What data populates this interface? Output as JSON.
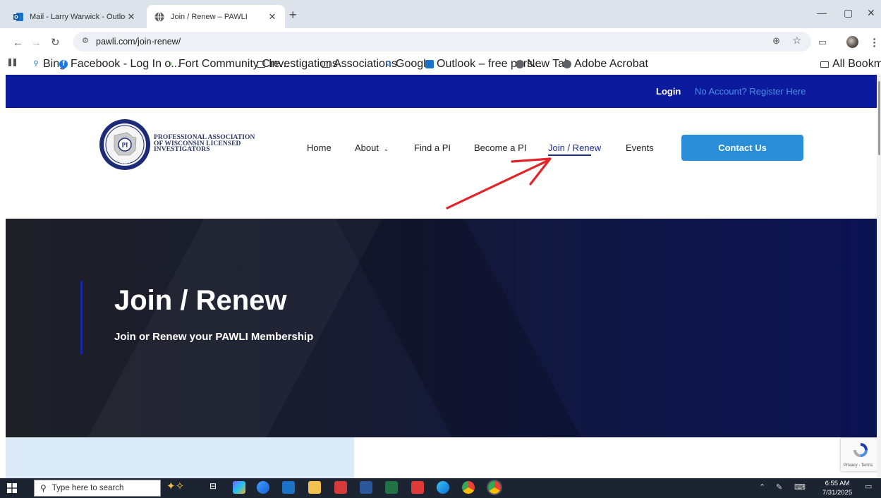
{
  "browser": {
    "tabs": [
      {
        "title": "Mail - Larry Warwick - Outlook",
        "active": false
      },
      {
        "title": "Join / Renew – PAWLI",
        "active": true
      }
    ],
    "new_tab_icon": "plus-icon",
    "url": "pawli.com/join-renew/",
    "bookmarks": [
      {
        "label": "Bing",
        "icon": "search-icon"
      },
      {
        "label": "Facebook - Log In o...",
        "icon": "facebook-icon"
      },
      {
        "label": "Fort Community Cre...",
        "icon": "bank-icon"
      },
      {
        "label": "Investigations",
        "icon": "folder-icon"
      },
      {
        "label": "Associations",
        "icon": "folder-icon"
      },
      {
        "label": "Google",
        "icon": "google-icon"
      },
      {
        "label": "Outlook – free pers...",
        "icon": "outlook-icon"
      },
      {
        "label": "New Tab",
        "icon": "globe-icon"
      },
      {
        "label": "Adobe Acrobat",
        "icon": "globe-icon"
      }
    ],
    "all_bookmarks": "All Bookmarks"
  },
  "site": {
    "topbar": {
      "login": "Login",
      "register": "No Account? Register Here"
    },
    "logo_text": [
      "PROFESSIONAL ASSOCIATION",
      "OF WISCONSIN LICENSED",
      "INVESTIGATORS"
    ],
    "logo_seal_text": "PAWLI",
    "nav": {
      "home": "Home",
      "about": "About",
      "find": "Find a PI",
      "become": "Become a PI",
      "join": "Join / Renew",
      "events": "Events",
      "contact": "Contact Us"
    },
    "hero": {
      "title": "Join / Renew",
      "subtitle": "Join or Renew your PAWLI Membership"
    },
    "recaptcha_terms": "Privacy - Terms"
  },
  "taskbar": {
    "search_placeholder": "Type here to search",
    "time": "6:55 AM",
    "date": "7/31/2025"
  },
  "colors": {
    "topbar": "#0c1a9e",
    "register_link": "#4c8ee6",
    "contact_button": "#2a8fd8",
    "annotation_arrow": "#e0242a"
  }
}
